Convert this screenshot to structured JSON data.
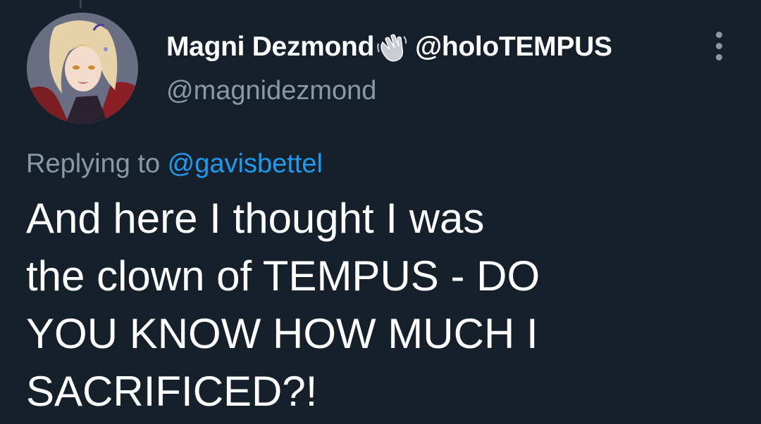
{
  "tweet": {
    "author": {
      "display_name": "Magni Dezmond",
      "badge_icon": "waving-hand-icon",
      "affiliation_handle": "@holoTEMPUS",
      "handle": "@magnidezmond"
    },
    "more_icon": "more-options-icon",
    "reply": {
      "prefix": "Replying to",
      "mention": "@gavisbettel"
    },
    "text_lines": [
      "And here I thought I was",
      "the clown of TEMPUS - DO",
      "YOU KNOW HOW MUCH I",
      "SACRIFICED?!"
    ]
  },
  "colors": {
    "background": "#15202b",
    "primary_text": "#ffffff",
    "secondary_text": "#8b98a5",
    "link": "#1d9bf0"
  }
}
